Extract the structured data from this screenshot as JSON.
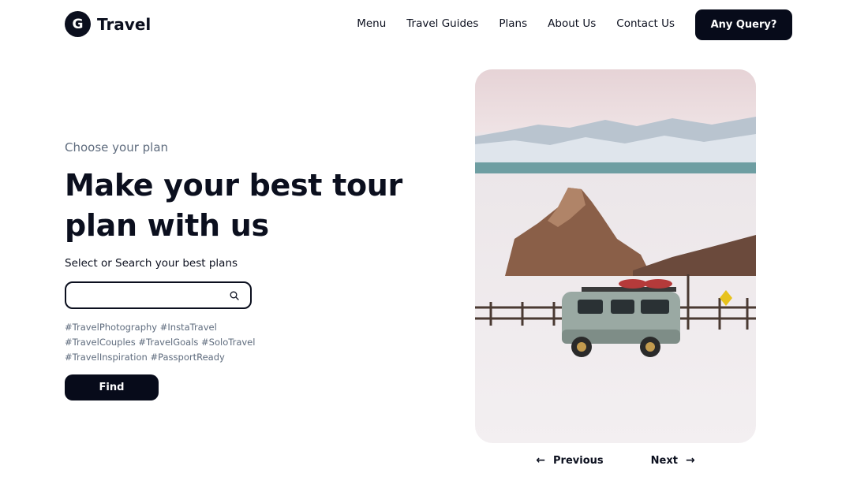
{
  "brand": {
    "mark": "G",
    "name": "Travel"
  },
  "nav": {
    "items": [
      "Menu",
      "Travel Guides",
      "Plans",
      "About Us",
      "Contact Us"
    ],
    "cta": "Any Query?"
  },
  "hero": {
    "eyebrow": "Choose your plan",
    "headline": "Make your best tour plan with us",
    "subline": "Select or Search your best plans",
    "search": {
      "value": "",
      "placeholder": ""
    },
    "tags": [
      "#TravelPhotography #InstaTravel",
      "#TravelCouples #TravelGoals #SoloTravel",
      "#TravelInspiration #PassportReady"
    ],
    "find_label": "Find"
  },
  "slider": {
    "previous_label": "Previous",
    "next_label": "Next"
  },
  "colors": {
    "primary": "#070b1a",
    "muted": "#5f6c7e",
    "background": "#ffffff"
  },
  "icons": [
    "search-icon",
    "arrow-left-icon",
    "arrow-right-icon"
  ]
}
